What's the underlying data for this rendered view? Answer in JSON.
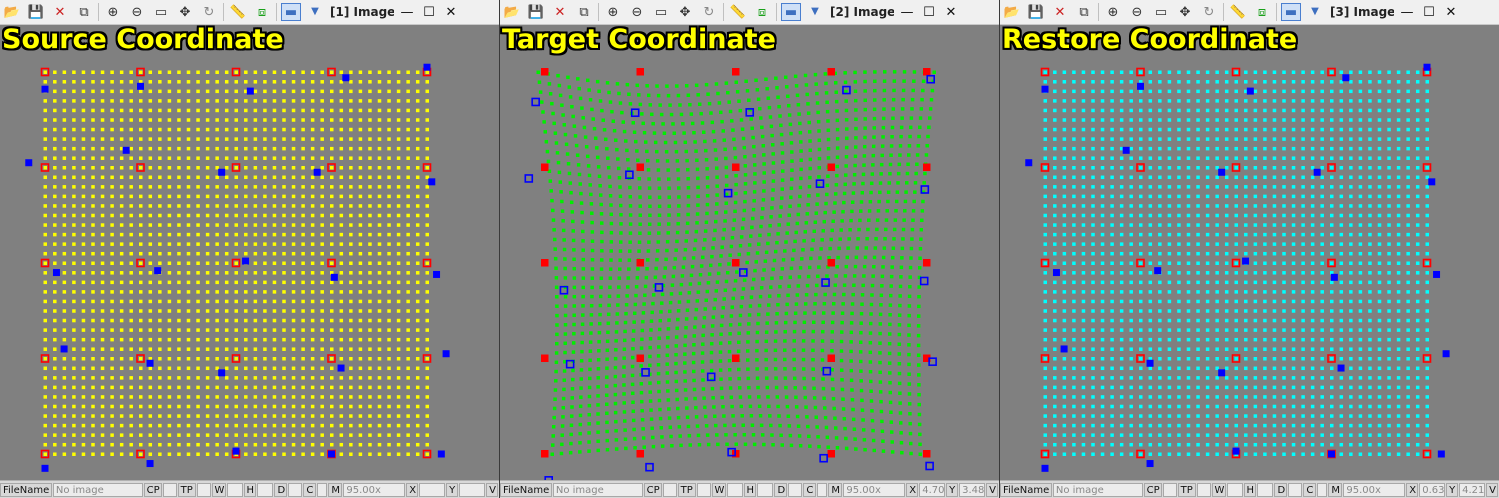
{
  "colors": {
    "grid_source": "#ffff00",
    "grid_target": "#00ee00",
    "grid_restore": "#00ffff",
    "control_point": "#ff0000",
    "marker": "#0000ff",
    "title": "#ffff00",
    "background": "#808080"
  },
  "toolbar_icons": [
    "open-folder-icon",
    "save-icon",
    "close-icon",
    "add-window-icon",
    "zoom-in-icon",
    "zoom-out-icon",
    "fit-window-icon",
    "move-icon",
    "rotate-icon",
    "ruler-icon",
    "overlay-icon",
    "display-mode-icon",
    "dropdown-arrow-icon",
    "minimize-icon",
    "maximize-icon",
    "close-window-icon"
  ],
  "panels": [
    {
      "title": "Source Coordinate",
      "tab_label": "[1] Image...",
      "status": {
        "filename_label": "FileName",
        "filename_value": "No image",
        "cp": "CP",
        "tp": "TP",
        "w": "W",
        "h": "H",
        "d": "D",
        "c": "C",
        "m": "M",
        "zoom": "95.00x",
        "x": "X",
        "x_val": "",
        "y": "Y",
        "y_val": "",
        "v": "V"
      }
    },
    {
      "title": "Target Coordinate",
      "tab_label": "[2] Image...",
      "status": {
        "filename_label": "FileName",
        "filename_value": "No image",
        "cp": "CP",
        "tp": "TP",
        "w": "W",
        "h": "H",
        "d": "D",
        "c": "C",
        "m": "M",
        "zoom": "95.00x",
        "x": "X",
        "x_val": "4.70",
        "y": "Y",
        "y_val": "3.48",
        "v": "V"
      }
    },
    {
      "title": "Restore Coordinate",
      "tab_label": "[3] Image...",
      "status": {
        "filename_label": "FileName",
        "filename_value": "No image",
        "cp": "CP",
        "tp": "TP",
        "w": "W",
        "h": "H",
        "d": "D",
        "c": "C",
        "m": "M",
        "zoom": "95.00x",
        "x": "X",
        "x_val": "0.63",
        "y": "Y",
        "y_val": "4.21",
        "v": "V"
      }
    }
  ]
}
